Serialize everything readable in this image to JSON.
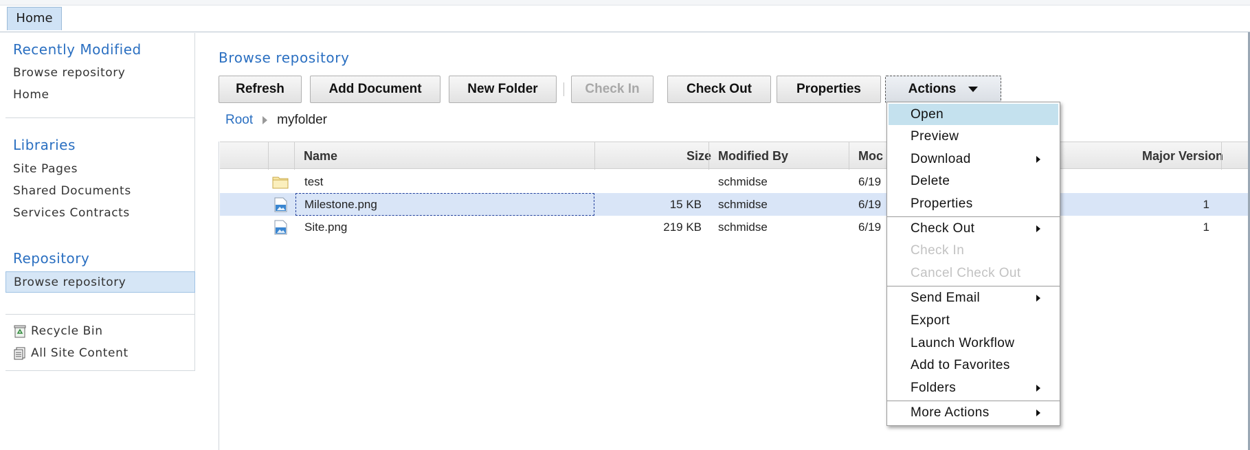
{
  "topbar": {
    "home_tab": "Home"
  },
  "sidebar": {
    "recent_heading": "Recently Modified",
    "recent_items": [
      "Browse repository",
      "Home"
    ],
    "libraries_heading": "Libraries",
    "library_items": [
      "Site Pages",
      "Shared Documents",
      "Services Contracts"
    ],
    "repository_heading": "Repository",
    "repository_items": [
      "Browse repository"
    ],
    "bottom_items": [
      {
        "label": "Recycle Bin",
        "icon": "recycle-bin-icon"
      },
      {
        "label": "All Site Content",
        "icon": "all-site-content-icon"
      }
    ]
  },
  "main": {
    "title": "Browse repository",
    "toolbar": {
      "refresh": "Refresh",
      "add_document": "Add Document",
      "new_folder": "New Folder",
      "check_in": "Check In",
      "check_out": "Check Out",
      "properties": "Properties",
      "actions": "Actions"
    },
    "breadcrumb": {
      "root": "Root",
      "current": "myfolder"
    },
    "table": {
      "headers": {
        "name": "Name",
        "size": "Size",
        "modified_by": "Modified By",
        "modified": "Moc",
        "major_version": "Major Version"
      },
      "rows": [
        {
          "name": "test",
          "size": "",
          "modified_by": "schmidse",
          "modified": "6/19",
          "major_version": "",
          "icon": "folder-icon"
        },
        {
          "name": "Milestone.png",
          "size": "15 KB",
          "modified_by": "schmidse",
          "modified": "6/19",
          "major_version": "1",
          "icon": "image-file-icon"
        },
        {
          "name": "Site.png",
          "size": "219 KB",
          "modified_by": "schmidse",
          "modified": "6/19",
          "major_version": "1",
          "icon": "image-file-icon"
        }
      ]
    }
  },
  "actions_menu": {
    "open": "Open",
    "preview": "Preview",
    "download": "Download",
    "delete": "Delete",
    "properties": "Properties",
    "check_out": "Check Out",
    "check_in": "Check In",
    "cancel_check_out": "Cancel Check Out",
    "send_email": "Send Email",
    "export": "Export",
    "launch_workflow": "Launch Workflow",
    "add_to_favorites": "Add to Favorites",
    "folders": "Folders",
    "more_actions": "More Actions"
  },
  "colors": {
    "accent_blue": "#2a6fc1",
    "menu_highlight": "#c4e1ee",
    "row_selected": "#d9e5f7"
  }
}
